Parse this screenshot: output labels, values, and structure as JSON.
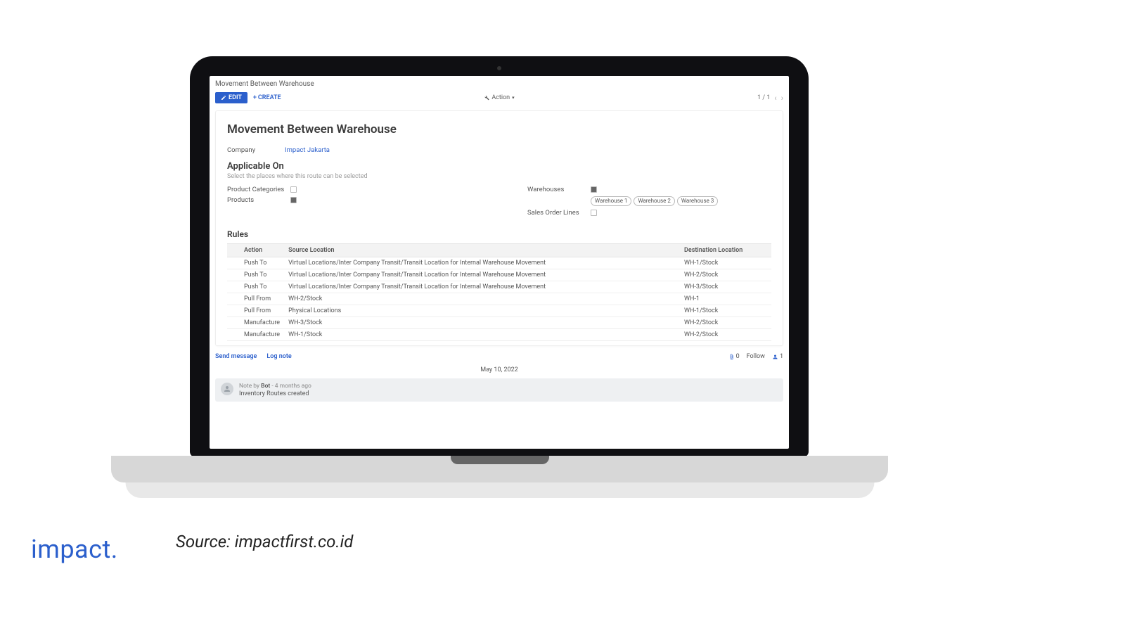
{
  "breadcrumb": "Movement Between Warehouse",
  "toolbar": {
    "edit": "EDIT",
    "create": "CREATE",
    "action": "Action"
  },
  "pager": {
    "current": "1",
    "total": "1"
  },
  "form": {
    "title": "Movement Between Warehouse",
    "company_label": "Company",
    "company_value": "Impact Jakarta",
    "applicable_on": "Applicable On",
    "applicable_sub": "Select the places where this route can be selected",
    "left_options": [
      {
        "label": "Product Categories",
        "checked": false
      },
      {
        "label": "Products",
        "checked": true
      }
    ],
    "right_options": [
      {
        "label": "Warehouses",
        "checked": true,
        "tags": [
          "Warehouse 1",
          "Warehouse 2",
          "Warehouse 3"
        ]
      },
      {
        "label": "Sales Order Lines",
        "checked": false
      }
    ],
    "rules_heading": "Rules",
    "rules_columns": {
      "action": "Action",
      "source": "Source Location",
      "dest": "Destination Location"
    },
    "rules": [
      {
        "action": "Push To",
        "source": "Virtual Locations/Inter Company Transit/Transit Location for Internal Warehouse Movement",
        "dest": "WH-1/Stock"
      },
      {
        "action": "Push To",
        "source": "Virtual Locations/Inter Company Transit/Transit Location for Internal Warehouse Movement",
        "dest": "WH-2/Stock"
      },
      {
        "action": "Push To",
        "source": "Virtual Locations/Inter Company Transit/Transit Location for Internal Warehouse Movement",
        "dest": "WH-3/Stock"
      },
      {
        "action": "Pull From",
        "source": "WH-2/Stock",
        "dest": "WH-1"
      },
      {
        "action": "Pull From",
        "source": "Physical Locations",
        "dest": "WH-1/Stock"
      },
      {
        "action": "Manufacture",
        "source": "WH-3/Stock",
        "dest": "WH-2/Stock"
      },
      {
        "action": "Manufacture",
        "source": "WH-1/Stock",
        "dest": "WH-2/Stock"
      }
    ]
  },
  "chatter": {
    "send": "Send message",
    "log": "Log note",
    "attach_count": "0",
    "follow": "Follow",
    "follower_count": "1",
    "date": "May 10, 2022",
    "note_author_prefix": "Note by ",
    "note_author": "Bot",
    "note_time": " - 4 months ago",
    "note_body": "Inventory Routes created"
  },
  "caption": {
    "brand": "impact.",
    "source": "Source: impactfirst.co.id"
  }
}
